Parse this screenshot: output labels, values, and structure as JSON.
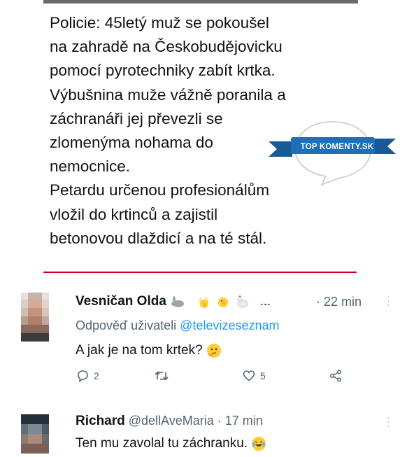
{
  "post": {
    "lines": [
      "Policie: 45letý muž se pokoušel",
      "na zahradě na Českobudějovicku",
      "pomocí pyrotechniky zabít krtka.",
      "Výbušnina muže vážně poranila a",
      "záchranáři jej převezli se",
      "zlomenýma nohama do",
      "nemocnice.",
      "Petardu určenou profesionálům",
      "vložil do krtinců a zajistil",
      "betonovou dlaždicí a na té stál."
    ]
  },
  "badge": {
    "text": "TOP KOMENTY.SK",
    "color": "#1f6fb8"
  },
  "tweets": [
    {
      "name": "Vesničan Olda",
      "name_emojis": [
        "rabbit-icon",
        "chick-icon",
        "chick-icon",
        "rooster-icon"
      ],
      "ellipsis": "...",
      "time": "· 22 min",
      "reply_prefix": "Odpověď uživateli",
      "reply_mention": "@televizeseznam",
      "text": "A jak je na tom krtek?",
      "text_emoji": "thinking-face-icon",
      "replies": "2",
      "likes": "5"
    },
    {
      "name": "Richard",
      "handle": "@dellAveMaria",
      "time": "· 17 min",
      "text": "Ten mu zavolal tu záchranku.",
      "text_emoji": "laughing-tears-icon"
    }
  ],
  "colors": {
    "accent": "#1d9bf0",
    "divider": "#d0021b",
    "muted": "#536471"
  }
}
